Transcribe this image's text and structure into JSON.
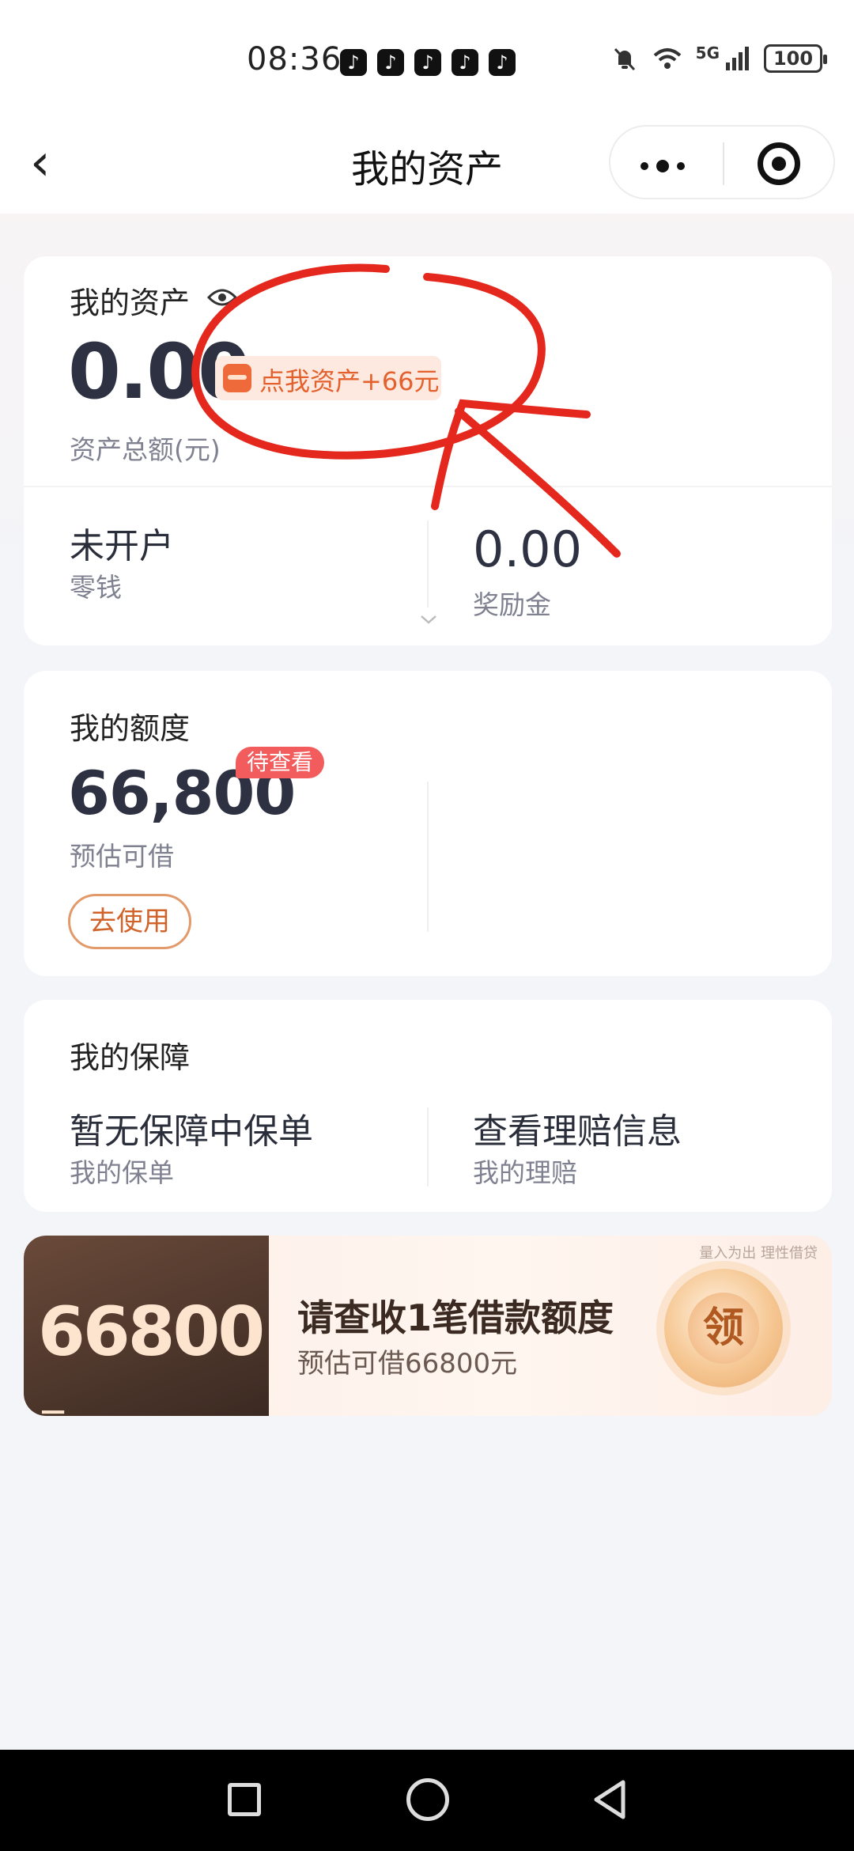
{
  "status_bar": {
    "time": "08:36",
    "network": "5G",
    "battery": "100",
    "app_notifications": [
      "tiktok-icon",
      "tiktok-icon",
      "tiktok-icon",
      "tiktok-icon",
      "tiktok-icon"
    ]
  },
  "nav": {
    "title": "我的资产"
  },
  "assets": {
    "title": "我的资产",
    "total": "0.00",
    "total_label": "资产总额(元)",
    "bonus_tag": "点我资产+66元",
    "change_status": "未开户",
    "change_label": "零钱",
    "reward_value": "0.00",
    "reward_label": "奖励金"
  },
  "credit": {
    "title": "我的额度",
    "amount": "66,800",
    "badge": "待查看",
    "label": "预估可借",
    "use_button": "去使用"
  },
  "protection": {
    "title": "我的保障",
    "policy_value": "暂无保障中保单",
    "policy_label": "我的保单",
    "claim_value": "查看理赔信息",
    "claim_label": "我的理赔"
  },
  "banner": {
    "amount": "66800",
    "unit": "元",
    "title": "请查收1笔借款额度",
    "subtitle": "预估可借66800元",
    "tip": "量入为出 理性借贷",
    "seal_text": "领"
  },
  "colors": {
    "accent": "#e4602c",
    "badge_red": "#f25c5c",
    "annotation_red": "#e5281d"
  }
}
